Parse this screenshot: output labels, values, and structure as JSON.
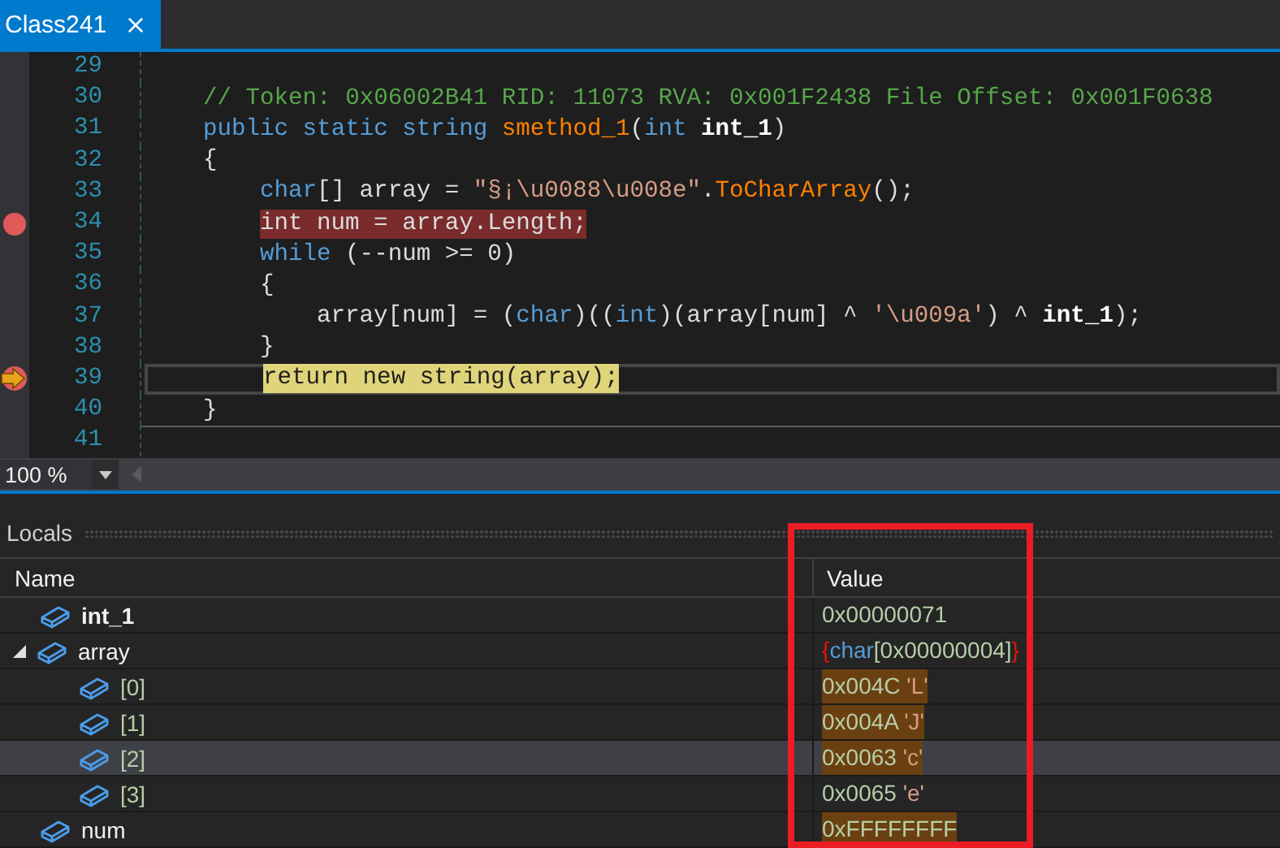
{
  "tabs": [
    {
      "label": "Class241",
      "selected": true
    }
  ],
  "code_lines": [
    {
      "number": "29",
      "breakpoint": false,
      "current": false
    },
    {
      "number": "30",
      "breakpoint": false,
      "current": false,
      "tokens": [
        {
          "text": "// Token: 0x06002B41 RID: 11073 RVA: 0x001F2438 File Offset: 0x001F0638",
          "kind": "comment"
        }
      ]
    },
    {
      "number": "31",
      "breakpoint": false,
      "current": false,
      "tokens": [
        {
          "text": "public static string ",
          "kind": "keyword"
        },
        {
          "text": "smethod_1",
          "kind": "method"
        },
        {
          "text": "(",
          "kind": "plain"
        },
        {
          "text": "int ",
          "kind": "keyword"
        },
        {
          "text": "int_1",
          "kind": "param"
        },
        {
          "text": ")",
          "kind": "plain"
        }
      ]
    },
    {
      "number": "32",
      "breakpoint": false,
      "current": false,
      "tokens": [
        {
          "text": "{",
          "kind": "plain"
        }
      ],
      "children": [
        {
          "number": "33",
          "breakpoint": false,
          "current": false,
          "tokens": [
            {
              "text": "char",
              "kind": "keyword"
            },
            {
              "text": "[] array = ",
              "kind": "plain"
            },
            {
              "text": "\"§¡\\u0088\\u008e\"",
              "kind": "string"
            },
            {
              "text": ".",
              "kind": "plain"
            },
            {
              "text": "ToCharArray",
              "kind": "method"
            },
            {
              "text": "();",
              "kind": "plain"
            }
          ]
        },
        {
          "number": "34",
          "breakpoint": true,
          "current": false,
          "tokens": [
            {
              "text": "int num = array.Length;",
              "kind": "plain"
            }
          ]
        },
        {
          "number": "35",
          "breakpoint": false,
          "current": false,
          "tokens": [
            {
              "text": "while",
              "kind": "keyword"
            },
            {
              "text": " (--num >= 0)",
              "kind": "plain"
            }
          ]
        },
        {
          "number": "36",
          "breakpoint": false,
          "current": false,
          "tokens": [
            {
              "text": "{",
              "kind": "plain"
            }
          ],
          "children": [
            {
              "number": "37",
              "breakpoint": false,
              "current": false,
              "tokens": [
                {
                  "text": "array[num] = (",
                  "kind": "plain"
                },
                {
                  "text": "char",
                  "kind": "keyword"
                },
                {
                  "text": ")((",
                  "kind": "plain"
                },
                {
                  "text": "int",
                  "kind": "keyword"
                },
                {
                  "text": ")(array[num] ^ ",
                  "kind": "plain"
                },
                {
                  "text": "'\\u009a'",
                  "kind": "string"
                },
                {
                  "text": ") ^ ",
                  "kind": "plain"
                },
                {
                  "text": "int_1",
                  "kind": "param"
                },
                {
                  "text": ");",
                  "kind": "plain"
                }
              ]
            }
          ]
        },
        {
          "number": "38",
          "breakpoint": false,
          "current": false,
          "tokens": [
            {
              "text": "}",
              "kind": "plain"
            }
          ]
        },
        {
          "number": "39",
          "breakpoint": true,
          "current": true,
          "tokens": [
            {
              "text": "return new string(array);",
              "kind": "plain"
            }
          ]
        }
      ]
    },
    {
      "number": "40",
      "breakpoint": false,
      "current": false,
      "rule_below": true,
      "tokens": [
        {
          "text": "}",
          "kind": "plain"
        }
      ]
    },
    {
      "number": "41",
      "breakpoint": false,
      "current": false
    }
  ],
  "zoom": {
    "value": "100 %"
  },
  "locals": {
    "title": "Locals",
    "columns": [
      "Name",
      "Value"
    ],
    "rows": [
      {
        "name": "int_1",
        "emphasized": true,
        "changed": false,
        "selected": false,
        "value": [
          {
            "text": "0x00000071",
            "kind": "plain"
          }
        ]
      },
      {
        "name": "array",
        "emphasized": false,
        "changed": false,
        "selected": false,
        "expanded": true,
        "value": [
          {
            "text": "{",
            "kind": "brace"
          },
          {
            "text": "char",
            "kind": "type"
          },
          {
            "text": "[0x00000004]",
            "kind": "plain"
          },
          {
            "text": "}",
            "kind": "brace"
          }
        ],
        "children": [
          {
            "name": "[0]",
            "emphasized": false,
            "changed": true,
            "selected": false,
            "value": [
              {
                "text": "0x004C ",
                "kind": "plain"
              },
              {
                "text": "'L'",
                "kind": "char"
              }
            ]
          },
          {
            "name": "[1]",
            "emphasized": false,
            "changed": true,
            "selected": false,
            "value": [
              {
                "text": "0x004A ",
                "kind": "plain"
              },
              {
                "text": "'J'",
                "kind": "char"
              }
            ]
          },
          {
            "name": "[2]",
            "emphasized": false,
            "changed": true,
            "selected": true,
            "value": [
              {
                "text": "0x0063 ",
                "kind": "plain"
              },
              {
                "text": "'c'",
                "kind": "char"
              }
            ]
          },
          {
            "name": "[3]",
            "emphasized": false,
            "changed": false,
            "selected": false,
            "value": [
              {
                "text": "0x0065 ",
                "kind": "plain"
              },
              {
                "text": "'e'",
                "kind": "char"
              }
            ]
          }
        ]
      },
      {
        "name": "num",
        "emphasized": false,
        "changed": true,
        "selected": false,
        "value": [
          {
            "text": "0xFFFFFFFF",
            "kind": "plain"
          }
        ]
      }
    ]
  }
}
